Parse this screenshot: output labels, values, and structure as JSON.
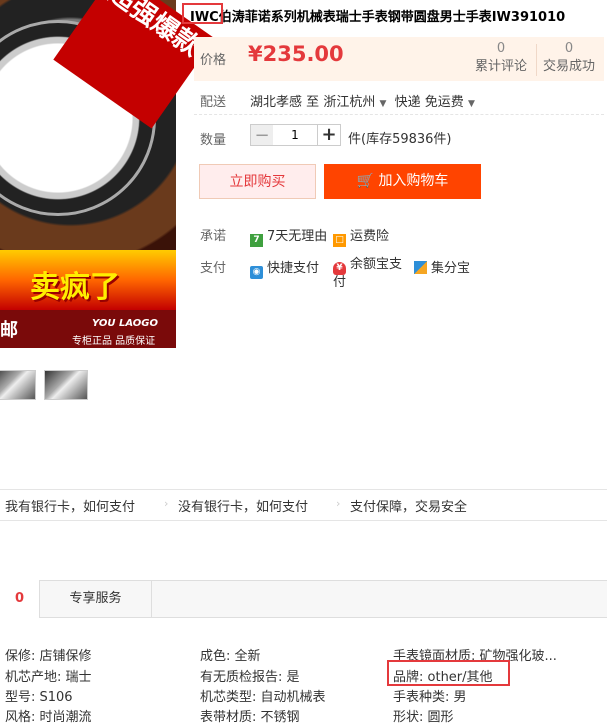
{
  "product_image": {
    "promo_ribbon": "超强爆款",
    "hot_text": "卖疯了",
    "strip_left": "邮",
    "strip_brand": "YOU LAOGO",
    "strip_slogan": "专柜正品 品质保证"
  },
  "title": "IWC伯涛菲诺系列机械表瑞士手表钢带圆盘男士手表IW391010",
  "price": {
    "label": "价格",
    "value": "¥235.00",
    "reviews_count": "0",
    "reviews_label": "累计评论",
    "sales_count": "0",
    "sales_label": "交易成功"
  },
  "shipping": {
    "label": "配送",
    "from": "湖北孝感",
    "to_word": "至",
    "to": "浙江杭州",
    "method": "快递 免运费"
  },
  "quantity": {
    "label": "数量",
    "value": "1",
    "minus": "−",
    "plus": "+",
    "stock_text": "件(库存59836件)"
  },
  "actions": {
    "buy_now": "立即购买",
    "add_cart": "加入购物车"
  },
  "promise": {
    "label": "承诺",
    "items": [
      "7天无理由",
      "运费险"
    ]
  },
  "payment": {
    "label": "支付",
    "items": [
      "快捷支付",
      "余额宝支付",
      "集分宝"
    ]
  },
  "help_links": [
    "我有银行卡，如何支付",
    "没有银行卡，如何支付",
    "支付保障，交易安全"
  ],
  "tabs": {
    "count": "0",
    "service": "专享服务"
  },
  "attributes": {
    "col1": [
      "保修: 店铺保修",
      "机芯产地: 瑞士",
      "型号: S106",
      "风格: 时尚潮流"
    ],
    "col2": [
      "成色: 全新",
      "有无质检报告: 是",
      "机芯类型: 自动机械表",
      "表带材质: 不锈钢"
    ],
    "col3": [
      "手表镜面材质: 矿物强化玻...",
      "品牌: other/其他",
      "手表种类: 男",
      "形状: 圆形"
    ]
  },
  "colors": {
    "accent": "#e4393c",
    "cart_button": "#ff4400",
    "price_bg": "#fff3e9"
  }
}
